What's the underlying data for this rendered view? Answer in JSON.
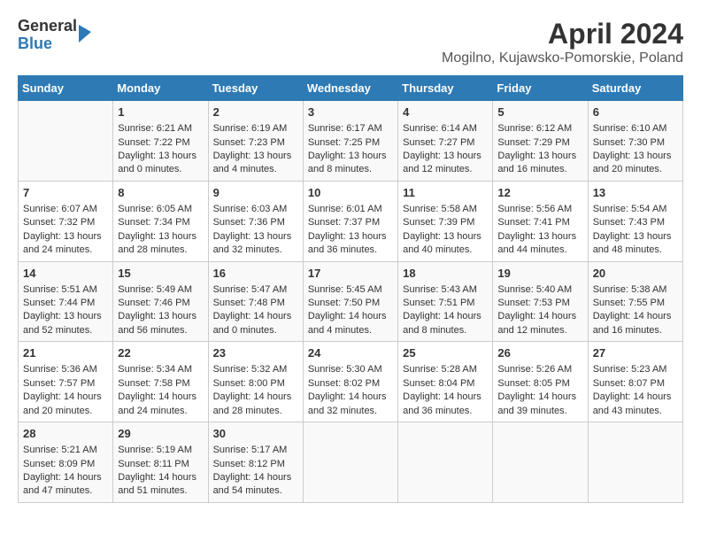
{
  "header": {
    "logo_line1": "General",
    "logo_line2": "Blue",
    "title": "April 2024",
    "subtitle": "Mogilno, Kujawsko-Pomorskie, Poland"
  },
  "days_of_week": [
    "Sunday",
    "Monday",
    "Tuesday",
    "Wednesday",
    "Thursday",
    "Friday",
    "Saturday"
  ],
  "weeks": [
    [
      {
        "day": "",
        "content": ""
      },
      {
        "day": "1",
        "content": "Sunrise: 6:21 AM\nSunset: 7:22 PM\nDaylight: 13 hours\nand 0 minutes."
      },
      {
        "day": "2",
        "content": "Sunrise: 6:19 AM\nSunset: 7:23 PM\nDaylight: 13 hours\nand 4 minutes."
      },
      {
        "day": "3",
        "content": "Sunrise: 6:17 AM\nSunset: 7:25 PM\nDaylight: 13 hours\nand 8 minutes."
      },
      {
        "day": "4",
        "content": "Sunrise: 6:14 AM\nSunset: 7:27 PM\nDaylight: 13 hours\nand 12 minutes."
      },
      {
        "day": "5",
        "content": "Sunrise: 6:12 AM\nSunset: 7:29 PM\nDaylight: 13 hours\nand 16 minutes."
      },
      {
        "day": "6",
        "content": "Sunrise: 6:10 AM\nSunset: 7:30 PM\nDaylight: 13 hours\nand 20 minutes."
      }
    ],
    [
      {
        "day": "7",
        "content": "Sunrise: 6:07 AM\nSunset: 7:32 PM\nDaylight: 13 hours\nand 24 minutes."
      },
      {
        "day": "8",
        "content": "Sunrise: 6:05 AM\nSunset: 7:34 PM\nDaylight: 13 hours\nand 28 minutes."
      },
      {
        "day": "9",
        "content": "Sunrise: 6:03 AM\nSunset: 7:36 PM\nDaylight: 13 hours\nand 32 minutes."
      },
      {
        "day": "10",
        "content": "Sunrise: 6:01 AM\nSunset: 7:37 PM\nDaylight: 13 hours\nand 36 minutes."
      },
      {
        "day": "11",
        "content": "Sunrise: 5:58 AM\nSunset: 7:39 PM\nDaylight: 13 hours\nand 40 minutes."
      },
      {
        "day": "12",
        "content": "Sunrise: 5:56 AM\nSunset: 7:41 PM\nDaylight: 13 hours\nand 44 minutes."
      },
      {
        "day": "13",
        "content": "Sunrise: 5:54 AM\nSunset: 7:43 PM\nDaylight: 13 hours\nand 48 minutes."
      }
    ],
    [
      {
        "day": "14",
        "content": "Sunrise: 5:51 AM\nSunset: 7:44 PM\nDaylight: 13 hours\nand 52 minutes."
      },
      {
        "day": "15",
        "content": "Sunrise: 5:49 AM\nSunset: 7:46 PM\nDaylight: 13 hours\nand 56 minutes."
      },
      {
        "day": "16",
        "content": "Sunrise: 5:47 AM\nSunset: 7:48 PM\nDaylight: 14 hours\nand 0 minutes."
      },
      {
        "day": "17",
        "content": "Sunrise: 5:45 AM\nSunset: 7:50 PM\nDaylight: 14 hours\nand 4 minutes."
      },
      {
        "day": "18",
        "content": "Sunrise: 5:43 AM\nSunset: 7:51 PM\nDaylight: 14 hours\nand 8 minutes."
      },
      {
        "day": "19",
        "content": "Sunrise: 5:40 AM\nSunset: 7:53 PM\nDaylight: 14 hours\nand 12 minutes."
      },
      {
        "day": "20",
        "content": "Sunrise: 5:38 AM\nSunset: 7:55 PM\nDaylight: 14 hours\nand 16 minutes."
      }
    ],
    [
      {
        "day": "21",
        "content": "Sunrise: 5:36 AM\nSunset: 7:57 PM\nDaylight: 14 hours\nand 20 minutes."
      },
      {
        "day": "22",
        "content": "Sunrise: 5:34 AM\nSunset: 7:58 PM\nDaylight: 14 hours\nand 24 minutes."
      },
      {
        "day": "23",
        "content": "Sunrise: 5:32 AM\nSunset: 8:00 PM\nDaylight: 14 hours\nand 28 minutes."
      },
      {
        "day": "24",
        "content": "Sunrise: 5:30 AM\nSunset: 8:02 PM\nDaylight: 14 hours\nand 32 minutes."
      },
      {
        "day": "25",
        "content": "Sunrise: 5:28 AM\nSunset: 8:04 PM\nDaylight: 14 hours\nand 36 minutes."
      },
      {
        "day": "26",
        "content": "Sunrise: 5:26 AM\nSunset: 8:05 PM\nDaylight: 14 hours\nand 39 minutes."
      },
      {
        "day": "27",
        "content": "Sunrise: 5:23 AM\nSunset: 8:07 PM\nDaylight: 14 hours\nand 43 minutes."
      }
    ],
    [
      {
        "day": "28",
        "content": "Sunrise: 5:21 AM\nSunset: 8:09 PM\nDaylight: 14 hours\nand 47 minutes."
      },
      {
        "day": "29",
        "content": "Sunrise: 5:19 AM\nSunset: 8:11 PM\nDaylight: 14 hours\nand 51 minutes."
      },
      {
        "day": "30",
        "content": "Sunrise: 5:17 AM\nSunset: 8:12 PM\nDaylight: 14 hours\nand 54 minutes."
      },
      {
        "day": "",
        "content": ""
      },
      {
        "day": "",
        "content": ""
      },
      {
        "day": "",
        "content": ""
      },
      {
        "day": "",
        "content": ""
      }
    ]
  ]
}
